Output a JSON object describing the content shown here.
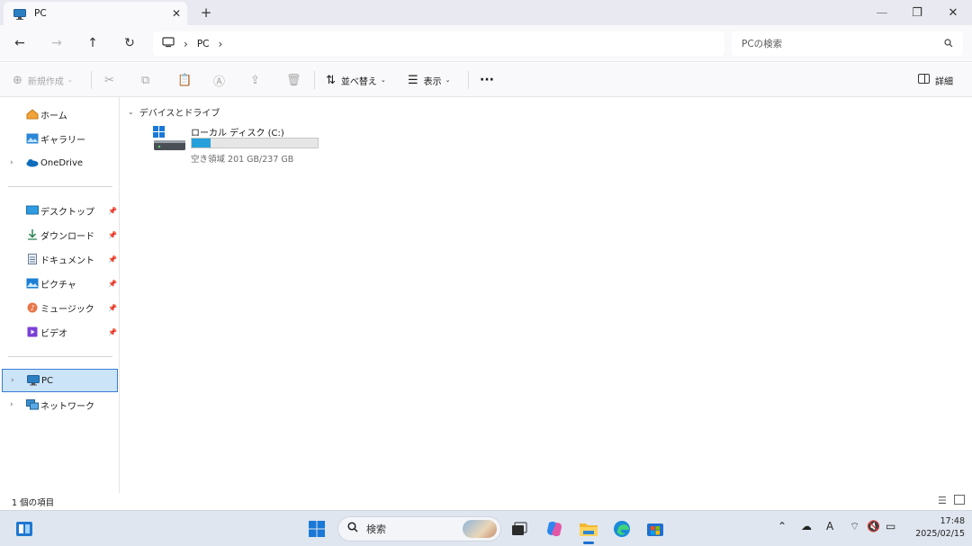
{
  "window": {
    "tab_title": "PC",
    "new_tab": "+",
    "close_tab": "✕",
    "minimize": "—",
    "restore": "❐",
    "close": "✕"
  },
  "nav": {
    "back": "←",
    "forward": "→",
    "up": "↑",
    "refresh": "↻"
  },
  "address": {
    "separator": "›",
    "crumb": "PC",
    "trailing": "›"
  },
  "search": {
    "placeholder": "PCの検索"
  },
  "toolbar": {
    "new": "新規作成",
    "sort": "並べ替え",
    "view": "表示",
    "more": "···",
    "details": "詳細"
  },
  "sidebar": {
    "home": "ホーム",
    "gallery": "ギャラリー",
    "onedrive": "OneDrive",
    "pinned": [
      {
        "label": "デスクトップ",
        "icon": "desktop-folder-icon"
      },
      {
        "label": "ダウンロード",
        "icon": "download-icon"
      },
      {
        "label": "ドキュメント",
        "icon": "document-icon"
      },
      {
        "label": "ピクチャ",
        "icon": "pictures-icon"
      },
      {
        "label": "ミュージック",
        "icon": "music-icon"
      },
      {
        "label": "ビデオ",
        "icon": "video-icon"
      }
    ],
    "pc": "PC",
    "network": "ネットワーク"
  },
  "content": {
    "group_header": "デバイスとドライブ",
    "drive": {
      "name": "ローカル ディスク (C:)",
      "free_text": "空き領域 201 GB/237 GB",
      "used_fraction": 0.15
    }
  },
  "status": {
    "item_count": "1 個の項目"
  },
  "taskbar": {
    "search_label": "検索",
    "time": "17:48",
    "date": "2025/02/15"
  },
  "colors": {
    "accent": "#26a0da",
    "selection": "#cce4f7"
  }
}
